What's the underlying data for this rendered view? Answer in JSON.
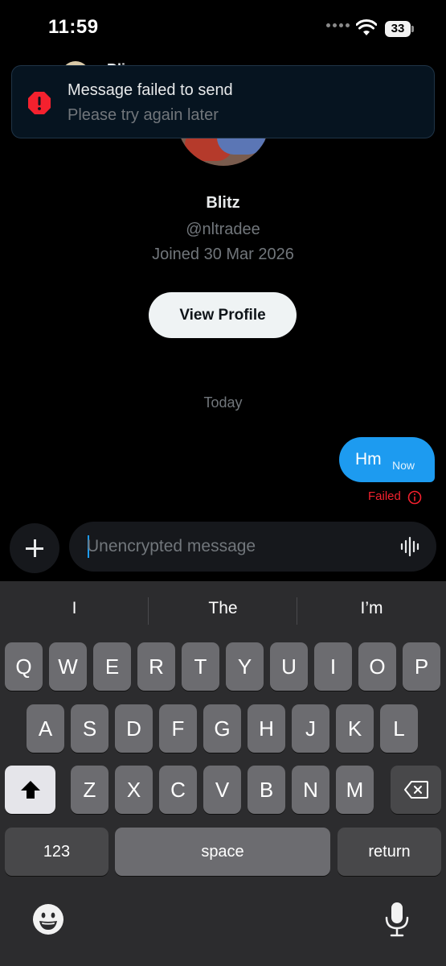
{
  "status_bar": {
    "time": "11:59",
    "battery": "33"
  },
  "header": {
    "name": "Bli"
  },
  "toast": {
    "title": "Message failed to send",
    "subtitle": "Please try again later"
  },
  "profile": {
    "name": "Blitz",
    "handle": "@nltradee",
    "joined": "Joined 30 Mar 2026",
    "button_label": "View Profile"
  },
  "conversation": {
    "day_label": "Today",
    "messages": [
      {
        "text": "Hm",
        "time": "Now",
        "status": "Failed"
      }
    ]
  },
  "composer": {
    "placeholder": "Unencrypted message"
  },
  "keyboard": {
    "suggestions": [
      "I",
      "The",
      "I’m"
    ],
    "row1": [
      "Q",
      "W",
      "E",
      "R",
      "T",
      "Y",
      "U",
      "I",
      "O",
      "P"
    ],
    "row2": [
      "A",
      "S",
      "D",
      "F",
      "G",
      "H",
      "J",
      "K",
      "L"
    ],
    "row3": [
      "Z",
      "X",
      "C",
      "V",
      "B",
      "N",
      "M"
    ],
    "numbers_label": "123",
    "space_label": "space",
    "return_label": "return"
  },
  "colors": {
    "accent": "#1d9bf0",
    "error": "#f4212e",
    "background": "#000000",
    "secondary_text": "#71767b"
  }
}
